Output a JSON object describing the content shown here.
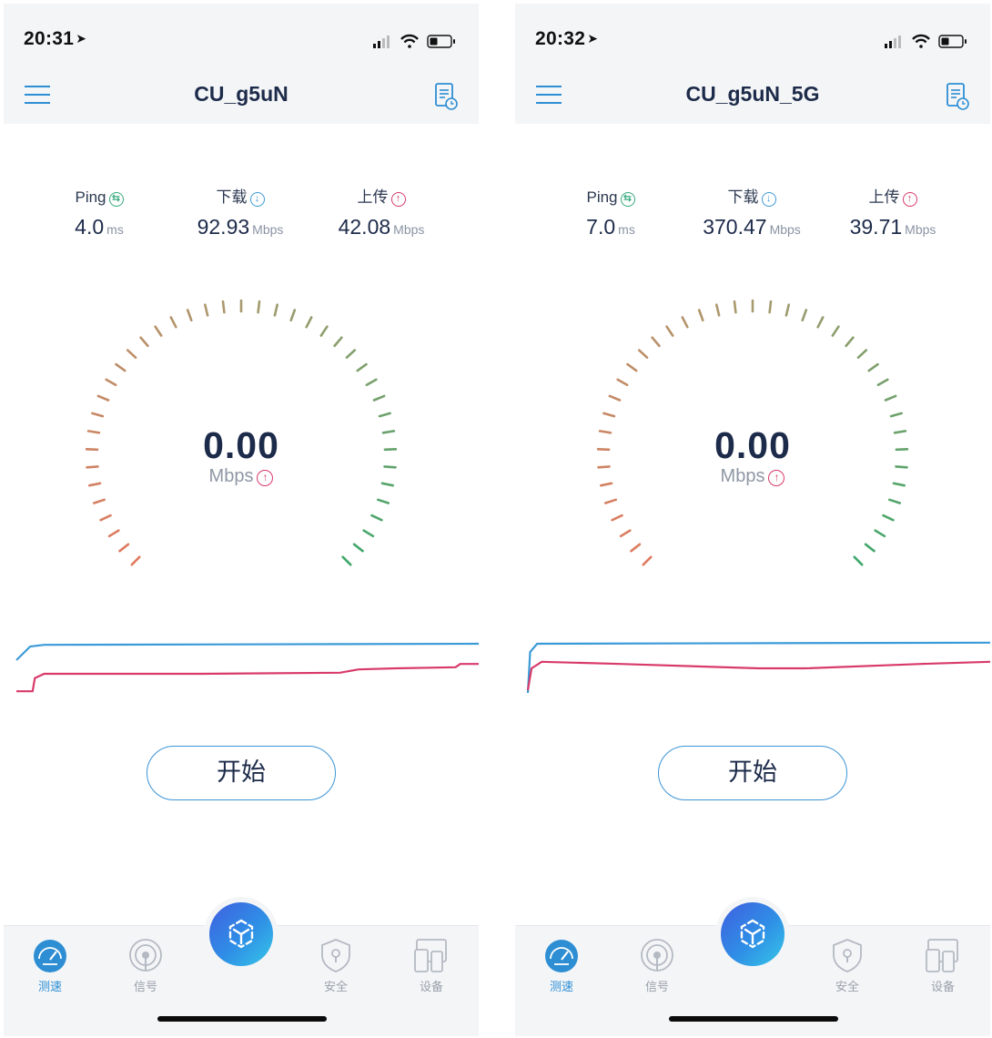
{
  "screens": [
    {
      "status_time": "20:31",
      "title": "CU_g5uN",
      "ping": {
        "label": "Ping",
        "value": "4.0",
        "unit": "ms"
      },
      "download": {
        "label": "下载",
        "value": "92.93",
        "unit": "Mbps"
      },
      "upload": {
        "label": "上传",
        "value": "42.08",
        "unit": "Mbps"
      },
      "speed": {
        "value": "0.00",
        "unit": "Mbps"
      },
      "start_label": "开始",
      "tabs": [
        "测速",
        "信号",
        "安全",
        "设备"
      ],
      "graph": {
        "download_line": [
          [
            0,
            0.35
          ],
          [
            3,
            0.1
          ],
          [
            6,
            0.07
          ],
          [
            100,
            0.05
          ]
        ],
        "upload_line": [
          [
            0,
            0.92
          ],
          [
            3.5,
            0.92
          ],
          [
            4,
            0.68
          ],
          [
            6,
            0.6
          ],
          [
            40,
            0.6
          ],
          [
            70,
            0.58
          ],
          [
            74,
            0.52
          ],
          [
            82,
            0.5
          ],
          [
            95,
            0.48
          ],
          [
            96,
            0.42
          ],
          [
            100,
            0.42
          ]
        ]
      }
    },
    {
      "status_time": "20:32",
      "title": "CU_g5uN_5G",
      "ping": {
        "label": "Ping",
        "value": "7.0",
        "unit": "ms"
      },
      "download": {
        "label": "下载",
        "value": "370.47",
        "unit": "Mbps"
      },
      "upload": {
        "label": "上传",
        "value": "39.71",
        "unit": "Mbps"
      },
      "speed": {
        "value": "0.00",
        "unit": "Mbps"
      },
      "start_label": "开始",
      "tabs": [
        "测速",
        "信号",
        "安全",
        "设备"
      ],
      "graph": {
        "download_line": [
          [
            0,
            0.95
          ],
          [
            0.5,
            0.2
          ],
          [
            2,
            0.05
          ],
          [
            100,
            0.03
          ]
        ],
        "upload_line": [
          [
            0,
            0.9
          ],
          [
            0.8,
            0.5
          ],
          [
            3,
            0.38
          ],
          [
            20,
            0.42
          ],
          [
            50,
            0.5
          ],
          [
            60,
            0.5
          ],
          [
            85,
            0.42
          ],
          [
            100,
            0.38
          ]
        ]
      }
    }
  ],
  "colors": {
    "accent": "#2d8ed4",
    "download": "#3b9ad8",
    "upload": "#d83a6a",
    "ping": "#36a87b",
    "gauge_low": "#e07a5f",
    "gauge_mid": "#a89a6e",
    "gauge_high": "#3fa86b"
  },
  "icons": {
    "menu": "hamburger-icon",
    "history": "history-icon",
    "tabs": [
      "speedometer-icon",
      "signal-icon",
      "shield-lock-icon",
      "devices-icon"
    ],
    "center": "cube-icon"
  }
}
